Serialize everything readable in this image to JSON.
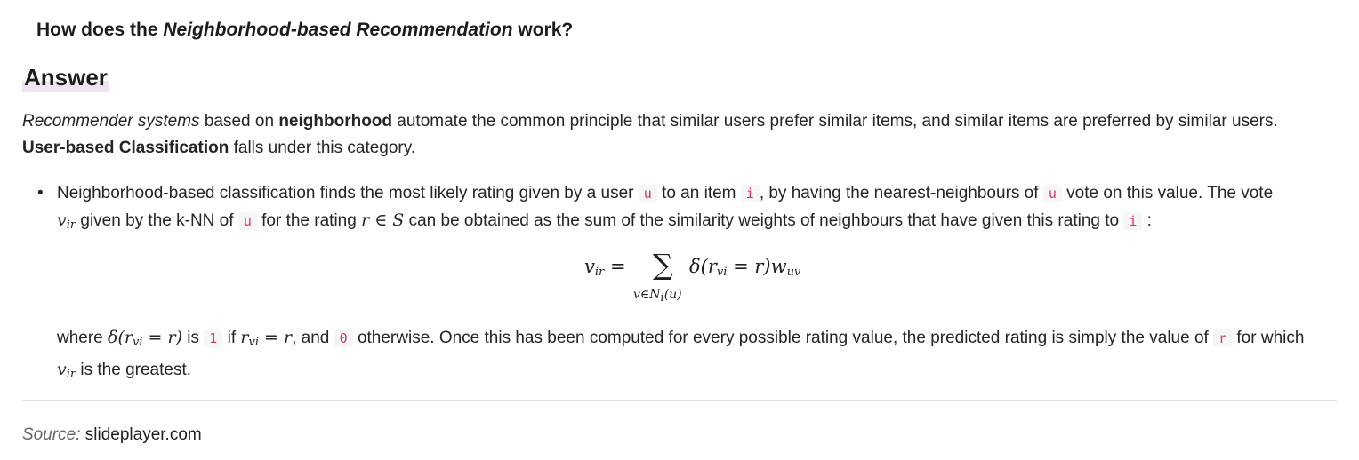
{
  "question": {
    "prefix": "How does the",
    "emphasis": "Neighborhood-based Recommendation",
    "suffix": "work?"
  },
  "answer_heading": "Answer",
  "intro": {
    "part1_em": "Recommender systems",
    "part2": "based on",
    "part3_bold": "neighborhood",
    "part4": "automate the common principle that similar users prefer similar items, and similar items are preferred by similar users.",
    "part5_bold": "User-based Classification",
    "part6": "falls under this category."
  },
  "bullet": {
    "t1": "Neighborhood-based classification finds the most likely rating given by a user",
    "code_u1": "u",
    "t2": "to an item",
    "code_i1": "i",
    "t3": ", by having the nearest-neighbours of",
    "code_u2": "u",
    "t4": "vote on this value. The vote",
    "m_v": "v",
    "m_v_sub": "ir",
    "t5": "given by the k-NN of",
    "code_u3": "u",
    "t6": "for the rating",
    "m_rs": "r ∈ S",
    "t7": "can be obtained as the sum of the similarity weights of neighbours that have given this rating to",
    "code_i2": "i",
    "t8": ":"
  },
  "equation": {
    "lhs": "v",
    "lhs_sub": "ir",
    "equals": "=",
    "sum": "∑",
    "under": "v∈N",
    "under_sub": "i",
    "under_tail": "(u)",
    "delta": "δ(r",
    "delta_sub": "vi",
    "delta_tail": "= r)w",
    "w_sub": "uv"
  },
  "where": {
    "t1": "where",
    "m_delta": "δ(r",
    "m_delta_sub": "vi",
    "m_delta_tail": "= r)",
    "t2": "is",
    "code_1": "1",
    "t3": "if",
    "m_r": "r",
    "m_r_sub": "vi",
    "m_r_tail": "= r",
    "t4": ", and",
    "code_0": "0",
    "t5": "otherwise. Once this has been computed for every possible rating value, the predicted rating is simply the value of",
    "code_r": "r",
    "t6": "for which",
    "m_v": "v",
    "m_v_sub": "ir",
    "t7": "is the greatest."
  },
  "source": {
    "label": "Source:",
    "value": "slideplayer.com"
  }
}
